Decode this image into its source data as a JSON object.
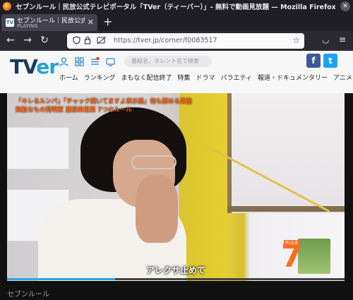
{
  "window": {
    "title": "セブンルール｜民放公式テレビポータル「TVer（ティーバー）」- 無料で動画見放題 — Mozilla Firefox",
    "close_glyph": "✕"
  },
  "tab": {
    "favicon": "TV",
    "title": "セブンルール｜民放公式テレビ",
    "status": "PLAYING",
    "close_glyph": "✕"
  },
  "new_tab_glyph": "+",
  "nav": {
    "back_glyph": "←",
    "forward_glyph": "→",
    "reload_glyph": "↻",
    "url": "https://tver.jp/corner/f0083517",
    "star_glyph": "☆",
    "pocket_glyph": "◡",
    "menu_glyph": "≡"
  },
  "site": {
    "logo_main": "TV",
    "logo_accent": "er",
    "search_placeholder": "番組名、タレント名で検索",
    "facebook": "f",
    "twitter": "t",
    "menu": [
      "ホーム",
      "ランキング",
      "まもなく配信終了",
      "特集",
      "ドラマ",
      "バラエティ",
      "報道・ドキュメンタリー",
      "アニメ"
    ]
  },
  "video": {
    "caption_top_line1": "「キレるルンバ」「チャック開いてますよ表示器」他も認める異能",
    "caption_top_line2": "無駄なもの発明家 藤原麻里菜 7つのルール",
    "subtitle": "アレクサ止めて",
    "badge_number": "7",
    "badge_label": "RULE",
    "progress": 0.32
  },
  "below_text": "セブンルール",
  "colors": {
    "accent_orange": "#ff6d1f",
    "tver_blue": "#29a3d3",
    "facebook": "#3b5998",
    "twitter": "#1da1f2",
    "progress": "#2aa7e0"
  }
}
